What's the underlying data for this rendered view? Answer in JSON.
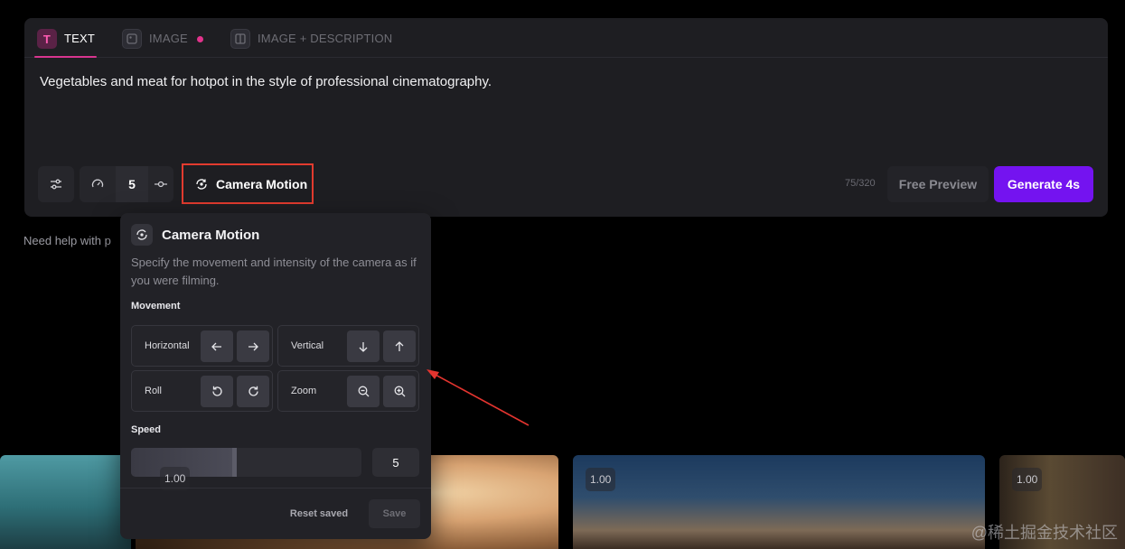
{
  "tabs": [
    {
      "label": "TEXT",
      "icon": "text-t-icon"
    },
    {
      "label": "IMAGE",
      "icon": "image-icon"
    },
    {
      "label": "IMAGE + DESCRIPTION",
      "icon": "image-description-icon"
    }
  ],
  "prompt": {
    "text": "Vegetables and meat for hotpot in the style of professional cinematography."
  },
  "toolbar": {
    "speed_value": "5",
    "camera_motion_label": "Camera Motion",
    "char_counter": "75/320",
    "free_preview_label": "Free Preview",
    "generate_label": "Generate 4s"
  },
  "help_text": "Need help with p",
  "thumbnails": [
    {
      "badge": "1.00"
    },
    {
      "badge": "1.00"
    },
    {
      "badge": "1.00"
    },
    {
      "badge": "1.00"
    }
  ],
  "popover": {
    "title": "Camera Motion",
    "description": "Specify the movement and intensity of the camera as if you were filming.",
    "movement_label": "Movement",
    "controls": [
      {
        "label": "Horizontal",
        "left_icon": "arrow-left-icon",
        "right_icon": "arrow-right-icon"
      },
      {
        "label": "Vertical",
        "left_icon": "arrow-down-icon",
        "right_icon": "arrow-up-icon"
      },
      {
        "label": "Roll",
        "left_icon": "rotate-ccw-icon",
        "right_icon": "rotate-cw-icon"
      },
      {
        "label": "Zoom",
        "left_icon": "zoom-out-icon",
        "right_icon": "zoom-in-icon"
      }
    ],
    "speed_label": "Speed",
    "speed_value": "5",
    "speed_fraction": 0.46,
    "reset_label": "Reset saved",
    "save_label": "Save"
  },
  "watermark": "@稀土掘金技术社区",
  "colors": {
    "accent": "#7413f0",
    "tab_accent": "#d8358f",
    "highlight_box": "#e23b2f"
  }
}
